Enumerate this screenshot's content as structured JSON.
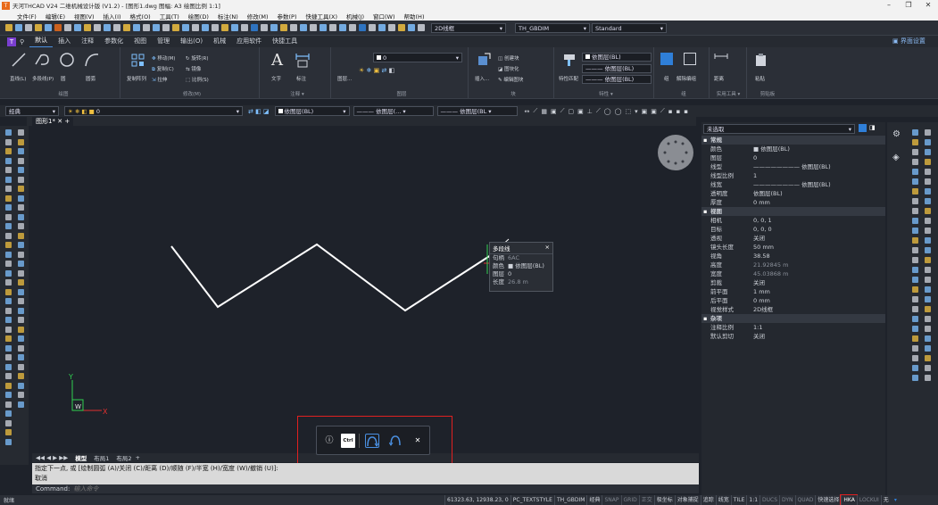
{
  "title": "天河THCAD V24 二维机械设计版 (V1.2) - [图形1.dwg 图幅: A3 绘图比例 1:1]",
  "menu": [
    "文件(F)",
    "编辑(E)",
    "视图(V)",
    "插入(I)",
    "格式(O)",
    "工具(T)",
    "绘图(D)",
    "标注(N)",
    "修改(M)",
    "参数(P)",
    "快捷工具(X)",
    "机械(J)",
    "窗口(W)",
    "帮助(H)"
  ],
  "quickbar": {
    "visual_style": "2D线框",
    "dimstyle": "TH_GBDIM",
    "textstyle": "Standard"
  },
  "ribbon_tabs": [
    "默认",
    "插入",
    "注释",
    "参数化",
    "视图",
    "管理",
    "输出(O)",
    "机械",
    "应用软件",
    "快捷工具"
  ],
  "ribbon_active_tab": "默认",
  "interface_settings": "界面设置",
  "ribbon": {
    "draw": {
      "label": "绘图",
      "items": [
        "直线(L)",
        "多段线(P)",
        "圆",
        "圆弧"
      ]
    },
    "modify": {
      "label": "修改(M)",
      "items": [
        "移动(M)",
        "复制(C)",
        "拉伸",
        "旋转(R)",
        "镜像",
        "比例(S)",
        "复制阵列",
        "阵列(A)"
      ]
    },
    "annotation": {
      "label": "注释 ▾",
      "items": [
        "文字",
        "标注"
      ]
    },
    "layers": {
      "label": "图层",
      "items": [
        "图层...",
        "0"
      ]
    },
    "block": {
      "label": "块",
      "items": [
        "插入...",
        "创建块",
        "图块化",
        "编辑图块"
      ]
    },
    "properties": {
      "label": "特性 ▾",
      "items": [
        "特性匹配",
        "依图层(BL)",
        "——— 依图层(BL)",
        "——— 依图层(BL)"
      ]
    },
    "groups": {
      "label": "组",
      "items": [
        "组",
        "解除编组"
      ]
    },
    "utilities": {
      "label": "实用工具 ▾",
      "items": [
        "距离"
      ]
    },
    "clipboard": {
      "label": "剪贴板",
      "items": [
        "粘贴"
      ]
    }
  },
  "propstrip": {
    "workspace": "经典",
    "layer": "0",
    "color": "依图层(BL)",
    "linetype": "——— 依图层(... ▾",
    "lineweight": "——— 依图层(BL ▾"
  },
  "doc_tab": "图形1*",
  "layout_tabs": [
    "模型",
    "布局1",
    "布局2"
  ],
  "ucs": {
    "x": "X",
    "y": "Y",
    "w": "W"
  },
  "tooltip": {
    "title": "多段线",
    "rows": [
      {
        "k": "句柄",
        "v": "6AC",
        "dim": true
      },
      {
        "k": "颜色",
        "v": "■ 依图层(BL)",
        "dim": false
      },
      {
        "k": "图层",
        "v": "0",
        "dim": false
      },
      {
        "k": "长度",
        "v": "26.8 m",
        "dim": true
      }
    ]
  },
  "float_buttons": [
    "Ctrl"
  ],
  "properties_panel": {
    "selection": "未选取",
    "sections": [
      {
        "name": "常规",
        "rows": [
          {
            "k": "颜色",
            "v": "■ 依图层(BL)"
          },
          {
            "k": "图层",
            "v": "0"
          },
          {
            "k": "线型",
            "v": "———————— 依图层(BL)"
          },
          {
            "k": "线型比例",
            "v": "1"
          },
          {
            "k": "线宽",
            "v": "———————— 依图层(BL)"
          },
          {
            "k": "透明度",
            "v": "依图层(BL)"
          },
          {
            "k": "厚度",
            "v": "0 mm"
          }
        ]
      },
      {
        "name": "视图",
        "rows": [
          {
            "k": "相机",
            "v": "0, 0, 1"
          },
          {
            "k": "目标",
            "v": "0, 0, 0"
          },
          {
            "k": "透视",
            "v": "关闭"
          },
          {
            "k": "镜头长度",
            "v": "50 mm"
          },
          {
            "k": "视角",
            "v": "38.58"
          },
          {
            "k": "高度",
            "v": "21.92845 m",
            "dim": true
          },
          {
            "k": "宽度",
            "v": "45.03868 m",
            "dim": true
          },
          {
            "k": "剪裁",
            "v": "关闭"
          },
          {
            "k": "前平面",
            "v": "1 mm"
          },
          {
            "k": "后平面",
            "v": "0 mm"
          },
          {
            "k": "视觉样式",
            "v": "2D线框"
          }
        ]
      },
      {
        "name": "杂项",
        "rows": [
          {
            "k": "注释比例",
            "v": "1:1"
          },
          {
            "k": "默认剪切",
            "v": "关闭"
          }
        ]
      }
    ]
  },
  "command": {
    "history1": "指定下一点, 或 [绘制圆弧 (A)/关闭 (C)/距离 (D)/顺随 (F)/半宽 (H)/宽度 (W)/撤销 (U)]:",
    "history2": "取消",
    "prompt": "Command:",
    "placeholder": "输入命令"
  },
  "status": {
    "left": "就绪",
    "items": [
      {
        "t": "61323.63, 12938.23, 0",
        "off": false
      },
      {
        "t": "PC_TEXTSTYLE",
        "off": false
      },
      {
        "t": "TH_GBDIM",
        "off": false
      },
      {
        "t": "经典",
        "off": false
      },
      {
        "t": "SNAP",
        "off": true
      },
      {
        "t": "GRID",
        "off": true
      },
      {
        "t": "正交",
        "off": true
      },
      {
        "t": "极坐标",
        "off": false
      },
      {
        "t": "对象捕捉",
        "off": false
      },
      {
        "t": "追踪",
        "off": false
      },
      {
        "t": "线宽",
        "off": false
      },
      {
        "t": "TILE",
        "off": false
      },
      {
        "t": "1:1",
        "off": false
      },
      {
        "t": "DUCS",
        "off": true
      },
      {
        "t": "DYN",
        "off": true
      },
      {
        "t": "QUAD",
        "off": true
      },
      {
        "t": "快速选择",
        "off": false
      },
      {
        "t": "HKA",
        "off": false
      },
      {
        "t": "LOCKUI",
        "off": true
      },
      {
        "t": "无",
        "off": false
      }
    ]
  },
  "colors": {
    "accent": "#4a8fe0",
    "highlight": "#e02020",
    "polyline": "#ffffff"
  }
}
